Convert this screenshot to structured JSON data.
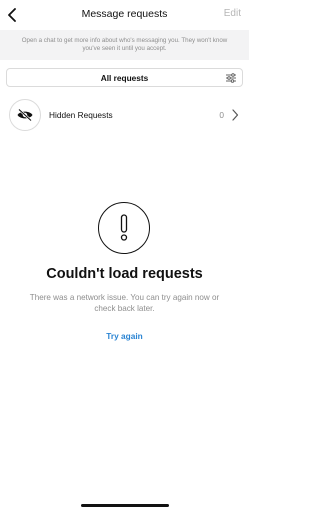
{
  "header": {
    "title": "Message requests",
    "edit_label": "Edit"
  },
  "info_banner": {
    "text": "Open a chat to get more info about who's messaging you. They won't know you've seen it until you accept."
  },
  "selector": {
    "label": "All requests"
  },
  "hidden_requests": {
    "label": "Hidden Requests",
    "count": "0"
  },
  "error": {
    "title": "Couldn't load requests",
    "message": "There was a network issue. You can try again now or check back later.",
    "retry_label": "Try again"
  },
  "colors": {
    "link": "#2a84d3",
    "muted_text": "#8e8e8e",
    "banner_bg": "#f3f3f4",
    "border": "#dbdbdb"
  },
  "icons": [
    "chevron-left-icon",
    "filter-sliders-icon",
    "eye-slash-icon",
    "chevron-right-icon",
    "exclamation-icon"
  ]
}
